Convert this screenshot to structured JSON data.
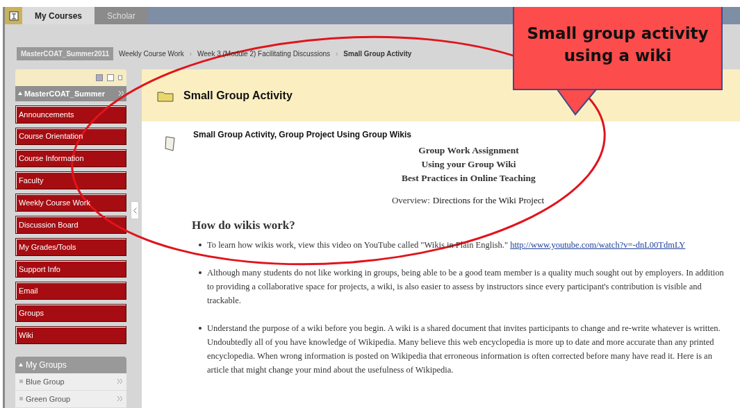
{
  "tabs": [
    {
      "label": "My Courses",
      "selected": true
    },
    {
      "label": "Scholar",
      "selected": false
    }
  ],
  "breadcrumb": {
    "course": "MasterCOAT_Summer2011",
    "separator": "›",
    "items": [
      "Weekly Course Work",
      "Week 3 (Module 2) Facilitating Discussions",
      "Small Group Activity"
    ]
  },
  "sidebar": {
    "course_title": "MasterCOAT_Summer",
    "items": [
      "Announcements",
      "Course Orientation",
      "Course Information",
      "Faculty",
      "Weekly Course Work",
      "Discussion Board",
      "My Grades/Tools",
      "Support Info",
      "Email",
      "Groups",
      "Wiki"
    ]
  },
  "groups": {
    "title": "My Groups",
    "items": [
      "Blue Group",
      "Green Group"
    ]
  },
  "page": {
    "title": "Small Group Activity",
    "item_title": "Small Group Activity, Group Project Using Group Wikis",
    "centered_lines": [
      "Group Work Assignment",
      "Using your Group Wiki",
      "Best Practices in Online Teaching"
    ],
    "overview_label": "Overview:",
    "overview_text": "Directions for the Wiki Project",
    "heading": "How do wikis work?",
    "bullets": [
      {
        "text": "To learn how wikis work, view this video on YouTube called \"Wikis in Plain English.\"",
        "link": "http://www.youtube.com/watch?v=-dnL00TdmLY"
      },
      {
        "text": "Although many students do not like working in groups, being able to be a good team member is a quality much sought out by employers. In addition to providing a collaborative space for projects, a wiki,  is also easier to assess by instructors since every participant's contribution is visible and trackable."
      },
      {
        "text": "Understand the purpose of a wiki before you begin. A wiki is a shared document that invites participants to change and re-write whatever is written. Undoubtedly all of you have knowledge of Wikipedia. Many believe this web encyclopedia is more up to date and more accurate than any printed encyclopedia. When wrong information is posted on Wikipedia that erroneous information is often corrected before many have read it. Here is an article that might change your mind about the usefulness of Wikipedia."
      }
    ]
  },
  "callout": {
    "text": "Small group activity using a wiki"
  }
}
